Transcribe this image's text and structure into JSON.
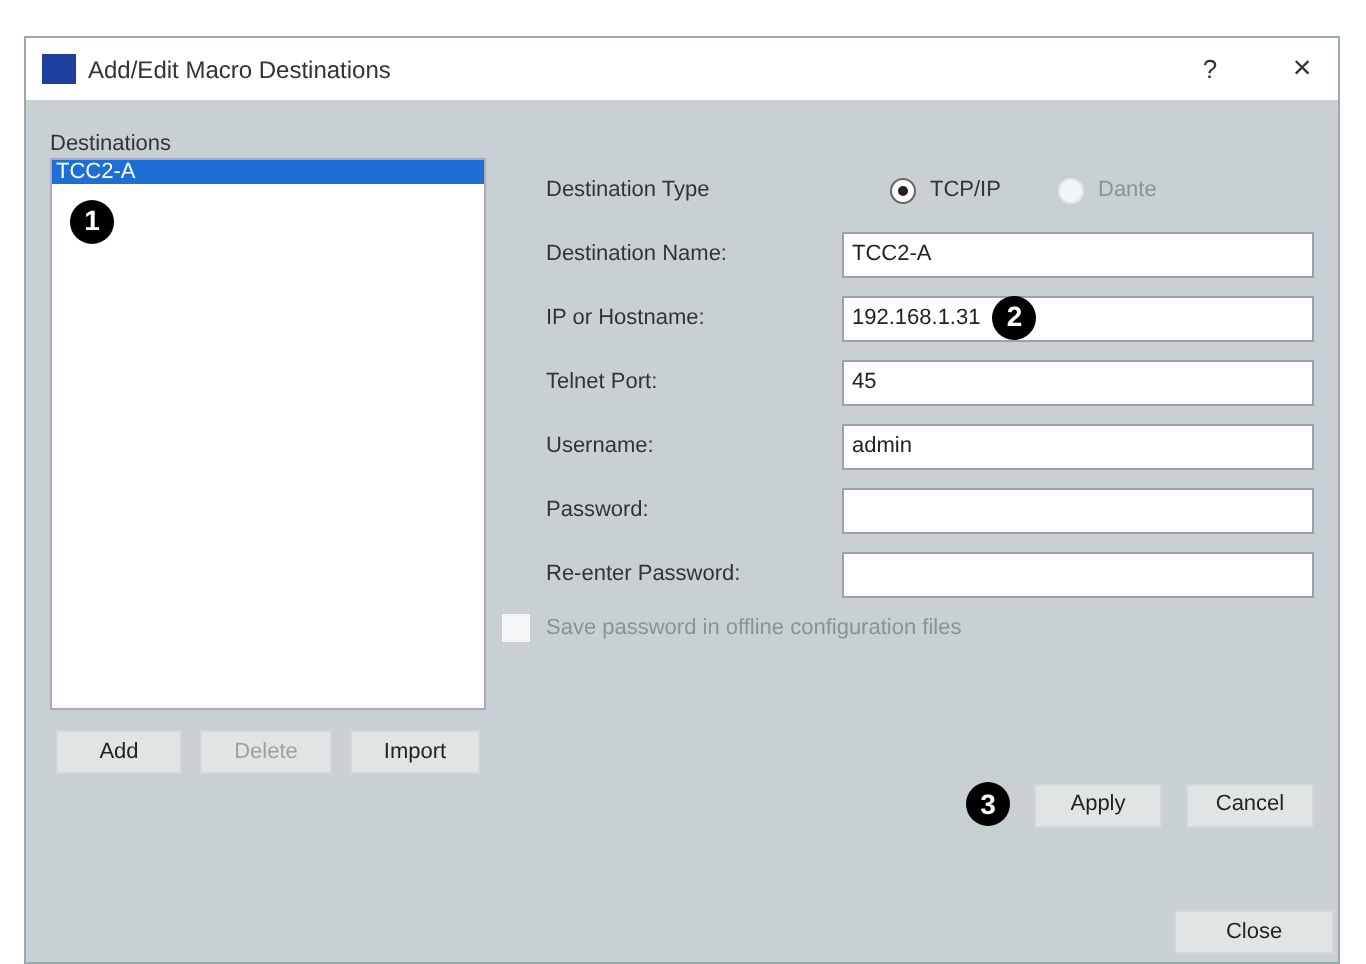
{
  "window": {
    "title": "Add/Edit Macro Destinations",
    "help": "?",
    "close": "×"
  },
  "destinations": {
    "label": "Destinations",
    "items": [
      {
        "label": "TCC2-A",
        "selected": true
      }
    ]
  },
  "destination_type": {
    "label": "Destination Type",
    "options": [
      {
        "label": "TCP/IP",
        "selected": true,
        "disabled": false
      },
      {
        "label": "Dante",
        "selected": false,
        "disabled": true
      }
    ]
  },
  "fields": [
    {
      "label": "Destination Name:",
      "value": "TCC2-A"
    },
    {
      "label": "IP or Hostname:",
      "value": "192.168.1.31"
    },
    {
      "label": "Telnet Port:",
      "value": "45"
    },
    {
      "label": "Username:",
      "value": "admin"
    },
    {
      "label": "Password:"
    },
    {
      "label": "Re-enter Password:"
    }
  ],
  "save_password": {
    "label": "Save password in offline configuration files",
    "checked": false,
    "disabled": true
  },
  "list_buttons": [
    {
      "label": "Add",
      "disabled": false
    },
    {
      "label": "Delete",
      "disabled": true
    },
    {
      "label": "Import",
      "disabled": false
    }
  ],
  "form_buttons": [
    {
      "label": "Apply"
    },
    {
      "label": "Cancel"
    }
  ],
  "close_button": "Close",
  "callouts": [
    "1",
    "2",
    "3"
  ]
}
